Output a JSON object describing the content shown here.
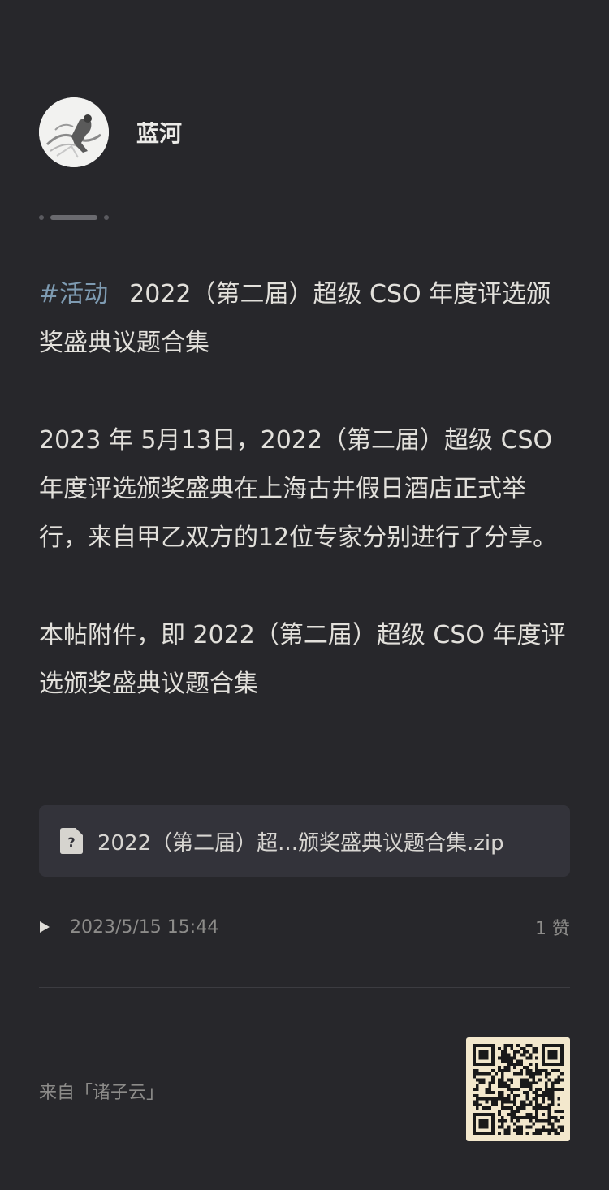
{
  "author": {
    "name": "蓝河"
  },
  "post": {
    "hashtag": "#活动",
    "title": "2022（第二届）超级 CSO 年度评选颁奖盛典议题合集",
    "paragraph1": "2023 年 5月13日，2022（第二届）超级 CSO 年度评选颁奖盛典在上海古井假日酒店正式举行，来自甲乙双方的12位专家分别进行了分享。",
    "paragraph2": "本帖附件，即 2022（第二届）超级 CSO 年度评选颁奖盛典议题合集"
  },
  "attachment": {
    "icon": "file-unknown-icon",
    "name": "2022（第二届）超...颁奖盛典议题合集.zip"
  },
  "meta": {
    "timestamp": "2023/5/15 15:44",
    "likes": "1 赞"
  },
  "footer": {
    "source": "来自「诸子云」"
  },
  "colors": {
    "background": "#27272b",
    "hashtag": "#7e9bb2",
    "attachment_bg": "#33333a",
    "qr_bg": "#f3e8cd"
  }
}
